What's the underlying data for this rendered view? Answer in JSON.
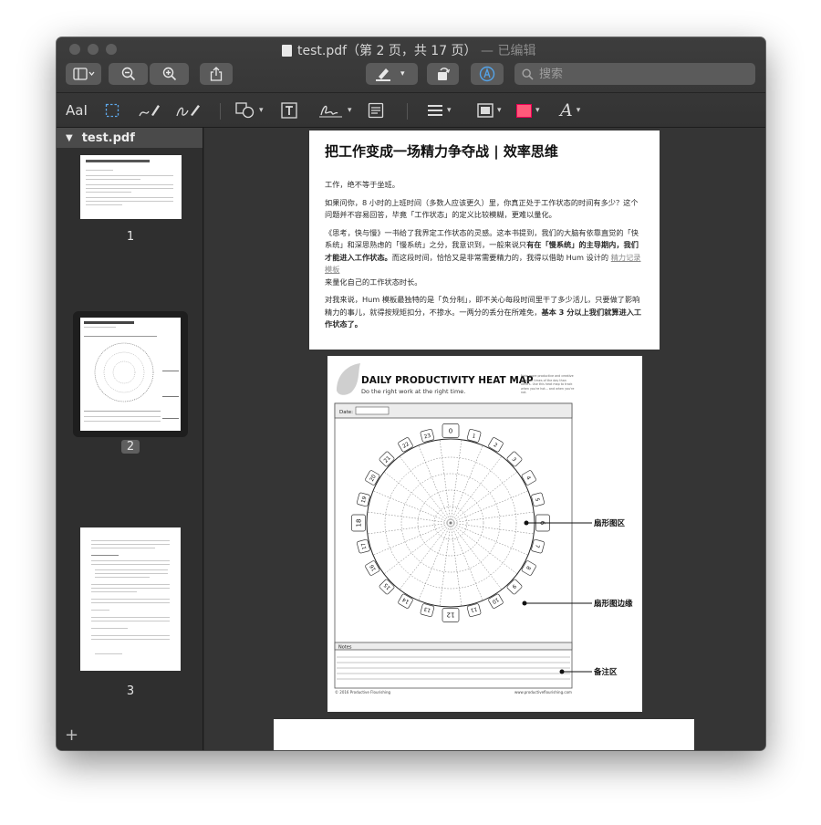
{
  "window": {
    "title": "test.pdf（第 2 页，共 17 页）",
    "edited": "— 已编辑"
  },
  "toolbar": {
    "search_placeholder": "搜索"
  },
  "sidebar": {
    "file_name": "test.pdf",
    "pages": [
      "1",
      "2",
      "3"
    ],
    "selected_page": "2",
    "add_label": "+"
  },
  "markup_toolbar": {
    "text_style_label": "AaI"
  },
  "document": {
    "page1": {
      "title": "把工作变成一场精力争夺战 | 效率思维",
      "p1": "工作，绝不等于坐班。",
      "p2": "如果问你，8 小时的上班时间（多数人应该更久）里，你真正处于工作状态的时间有多少？这个问题并不容易回答，毕竟「工作状态」的定义比较模糊，更难以量化。",
      "p3a": "《思考，快与慢》一书给了我界定工作状态的灵感。这本书提到，我们的大脑有依靠直觉的「快系统」和深思熟虑的「慢系统」之分，我意识到，一般来说只",
      "p3b": "有在「慢系统」的主导期内，我们才能进入工作状态。",
      "p3c": "而这段时间，恰恰又是非常需要精力的，我得以借助 Hum 设计的",
      "p3link": "精力记录模板",
      "p3d": "来量化自己的工作状态时长。",
      "p4a": "对我来说，Hum 模板最独特的是「负分制」，即不关心每段时间里干了多少活儿，只要做了影响精力的事儿，就得按规矩扣分，不掺水。一两分的丢分在所难免，",
      "p4b": "基本 3 分以上我们就算进入工作状态了。"
    },
    "page2": {
      "heading": "DAILY PRODUCTIVITY HEAT MAP",
      "subheading": "Do the right work at the right time.",
      "side_note": "Note more productive and creative at some times of the day than others. Use this heat map to track when you're hot... and when you're not.",
      "date_label": "Date:",
      "notes_label": "Notes",
      "copyright": "© 2016 Productive Flourishing",
      "url": "www.productiveflourishing.com",
      "annotations": [
        "扇形图区",
        "扇形图边缘",
        "备注区"
      ],
      "hours": [
        "0",
        "1",
        "2",
        "3",
        "4",
        "5",
        "6",
        "7",
        "8",
        "9",
        "10",
        "11",
        "12",
        "13",
        "14",
        "15",
        "16",
        "17",
        "18",
        "19",
        "20",
        "21",
        "22",
        "23"
      ]
    }
  }
}
